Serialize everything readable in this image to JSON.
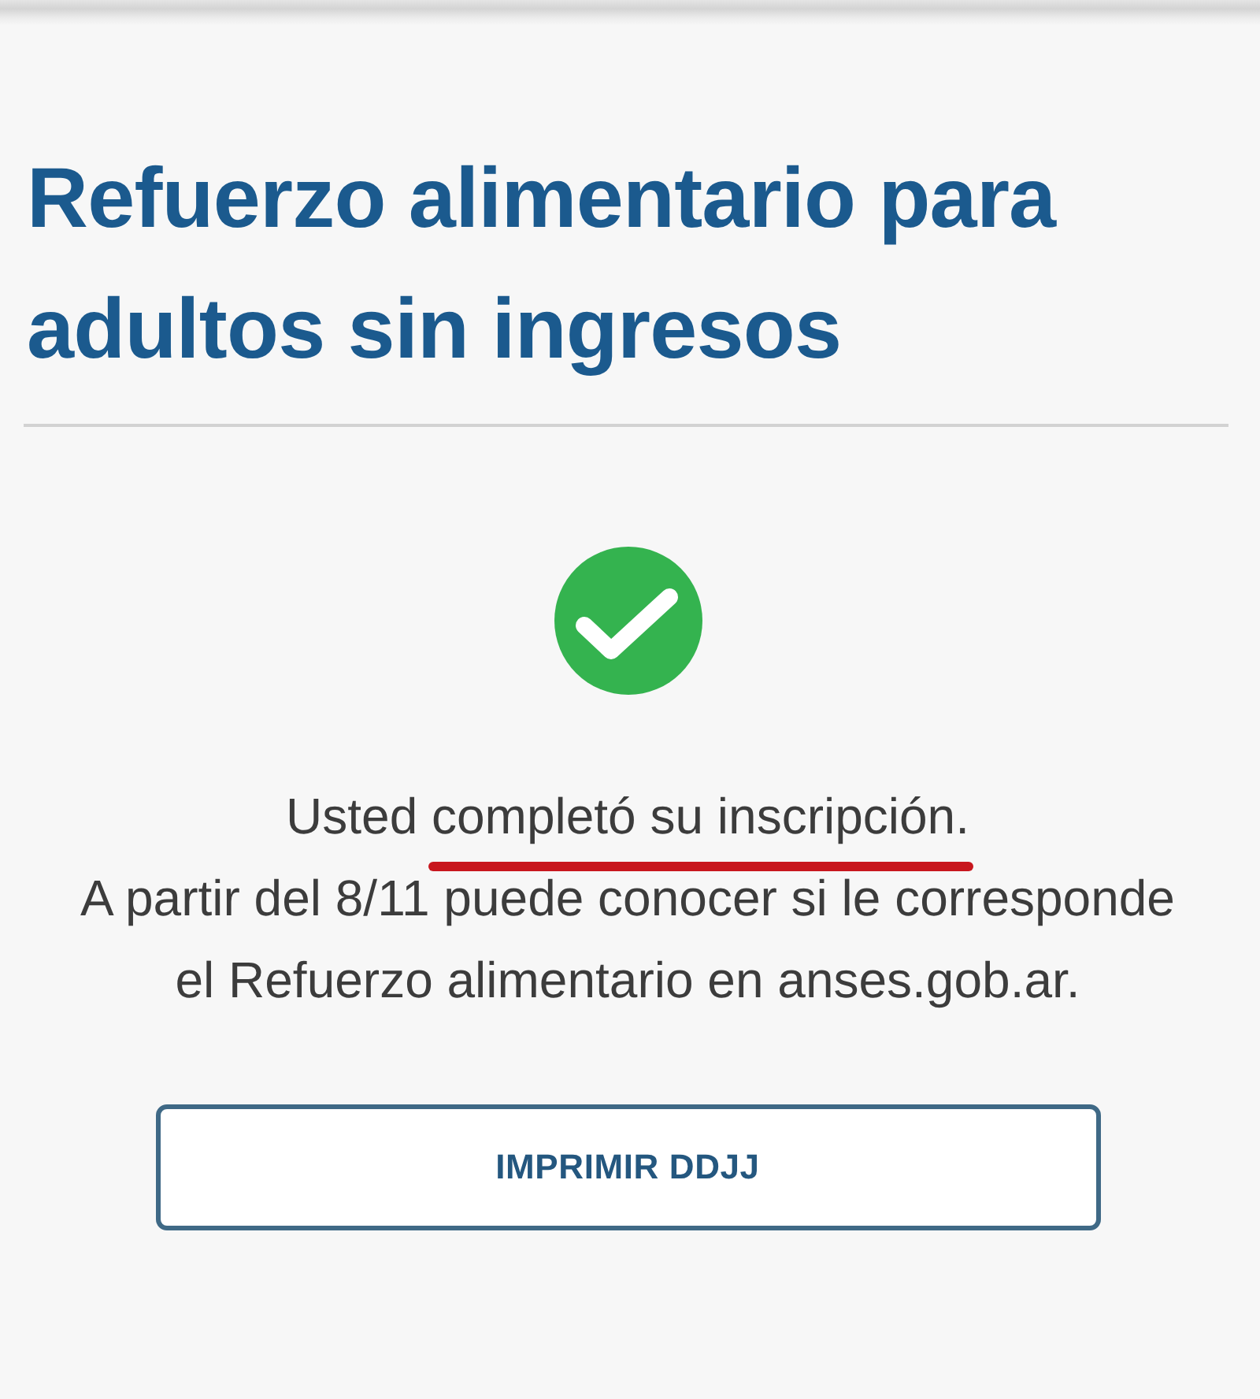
{
  "title": "Refuerzo alimentario para adultos sin ingresos",
  "confirmation": {
    "parts": [
      {
        "text": "Usted",
        "underlined": false
      },
      {
        "text": "completó su inscripción.",
        "underlined": true
      }
    ]
  },
  "info": "A partir del 8/11 puede conocer si le corresponde el Refuerzo alimentario en anses.gob.ar.",
  "button": {
    "label": "IMPRIMIR DDJJ"
  }
}
